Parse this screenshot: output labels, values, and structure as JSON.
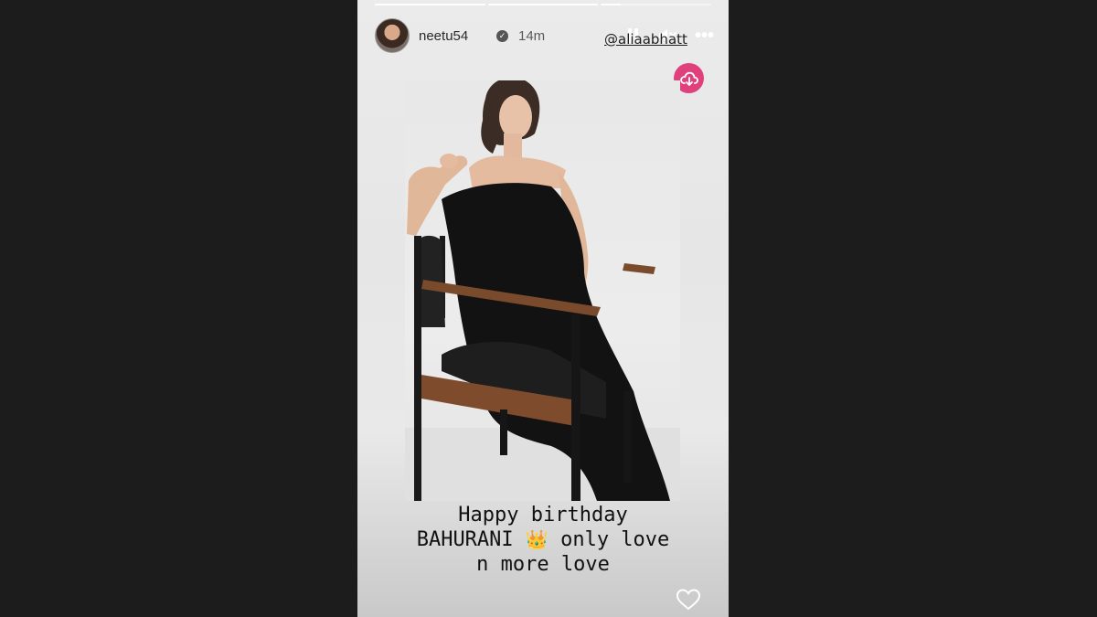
{
  "story": {
    "progress": [
      1,
      1,
      0.18,
      0
    ],
    "user": {
      "username": "neetu54",
      "verified_icon": "verified-badge-icon",
      "time_ago": "14m"
    },
    "controls": {
      "pause_icon": "pause-icon",
      "mute_icon": "speaker-muted-icon",
      "more_icon": "more-dots-icon",
      "more_glyph": "•••",
      "download_icon": "cloud-download-icon"
    },
    "mention_sticker": "@aliaabhatt",
    "caption": {
      "line1": "Happy birthday",
      "line2_prefix": "BAHURANI",
      "line2_emoji": "👑",
      "line2_suffix": "only love",
      "line3": "n more love"
    },
    "like_icon": "heart-outline-icon"
  },
  "colors": {
    "page_background": "#1c1c1c",
    "download_button": "#e0407c",
    "caption_text": "#111111"
  }
}
